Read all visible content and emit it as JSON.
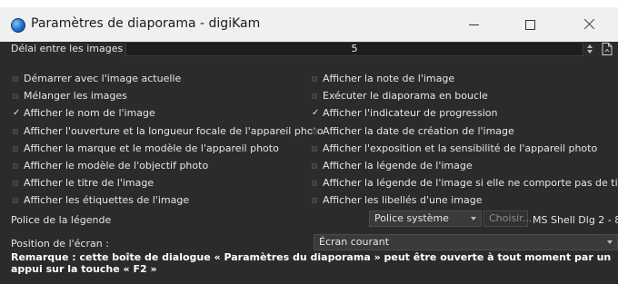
{
  "window": {
    "title": "Paramètres de diaporama - digiKam"
  },
  "delay": {
    "label": "Délai entre les images :",
    "value": "5"
  },
  "options_left": [
    {
      "label": "Démarrer avec l'image actuelle",
      "checked": false
    },
    {
      "label": "Mélanger les images",
      "checked": false
    },
    {
      "label": "Afficher le nom de l'image",
      "checked": true
    },
    {
      "label": "Afficher l'ouverture et la longueur focale de l'appareil photo",
      "checked": false
    },
    {
      "label": "Afficher la marque et le modèle de l'appareil photo",
      "checked": false
    },
    {
      "label": "Afficher le modèle de l'objectif photo",
      "checked": false
    },
    {
      "label": "Afficher le titre de l'image",
      "checked": false
    },
    {
      "label": "Afficher les étiquettes de l'image",
      "checked": false
    }
  ],
  "options_right": [
    {
      "label": "Afficher la note de l'image",
      "checked": false
    },
    {
      "label": "Exécuter le diaporama en boucle",
      "checked": false
    },
    {
      "label": "Afficher l'indicateur de progression",
      "checked": true
    },
    {
      "label": "Afficher la date de création de l'image",
      "checked": false
    },
    {
      "label": "Afficher l'exposition et la sensibilité de l'appareil photo",
      "checked": false
    },
    {
      "label": "Afficher la légende de l'image",
      "checked": false
    },
    {
      "label": "Afficher la légende de l'image si elle ne comporte pas de titre",
      "checked": false
    },
    {
      "label": "Afficher les libellés d'une image",
      "checked": false
    }
  ],
  "caption_font": {
    "label": "Police de la légende",
    "selected": "Police système",
    "choose_label": "Choisir...",
    "font_desc": "MS Shell Dlg 2 - 8"
  },
  "screen_position": {
    "label": "Position de l'écran :",
    "selected": "Écran courant"
  },
  "remark": "Remarque : cette boîte de dialogue « Paramètres du diaporama » peut être ouverte à tout moment par un appui sur la touche « F2 »",
  "checkmark": "✓",
  "icons": {
    "app": "digikam-app-icon",
    "minimize": "minimize-icon",
    "maximize": "maximize-icon",
    "close": "close-icon",
    "page": "page-icon"
  }
}
